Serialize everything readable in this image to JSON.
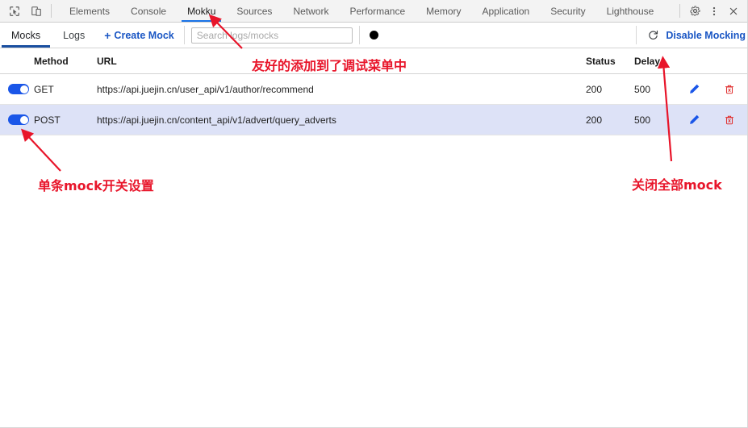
{
  "devtools": {
    "left_icons": [
      {
        "name": "inspect-element-icon",
        "title": "Inspect element"
      },
      {
        "name": "device-toolbar-icon",
        "title": "Toggle device toolbar"
      }
    ],
    "tabs": [
      {
        "label": "Elements",
        "active": false
      },
      {
        "label": "Console",
        "active": false
      },
      {
        "label": "Mokku",
        "active": true
      },
      {
        "label": "Sources",
        "active": false
      },
      {
        "label": "Network",
        "active": false
      },
      {
        "label": "Performance",
        "active": false
      },
      {
        "label": "Memory",
        "active": false
      },
      {
        "label": "Application",
        "active": false
      },
      {
        "label": "Security",
        "active": false
      },
      {
        "label": "Lighthouse",
        "active": false
      }
    ],
    "right_icons": [
      {
        "name": "gear-icon",
        "title": "Settings"
      },
      {
        "name": "kebab-menu-icon",
        "title": "Customize and control DevTools"
      },
      {
        "name": "close-icon",
        "title": "Close DevTools"
      }
    ],
    "active_tab_underline_color": "#1a73e8"
  },
  "toolbar": {
    "tabs": [
      {
        "label": "Mocks",
        "active": true
      },
      {
        "label": "Logs",
        "active": false
      }
    ],
    "create_mock_label": "Create Mock",
    "create_mock_plus": "+",
    "search": {
      "placeholder": "Search logs/mocks",
      "value": ""
    },
    "record_button_name": "record-dot-button",
    "refresh_button_name": "refresh-icon",
    "disable_mocking_label": "Disable Mocking",
    "accent_color": "#1a56c4",
    "active_tab_underline_color": "#1a4fa0"
  },
  "table": {
    "headers": {
      "toggle": "",
      "method": "Method",
      "url": "URL",
      "status": "Status",
      "delay": "Delay"
    },
    "rows": [
      {
        "enabled": true,
        "method": "GET",
        "url": "https://api.juejin.cn/user_api/v1/author/recommend",
        "status": "200",
        "delay": "500",
        "selected": false
      },
      {
        "enabled": true,
        "method": "POST",
        "url": "https://api.juejin.cn/content_api/v1/advert/query_adverts",
        "status": "200",
        "delay": "500",
        "selected": true
      }
    ],
    "selected_row_color": "#dde2f7",
    "edit_icon_color": "#1a56e8",
    "delete_icon_color": "#e03030"
  },
  "annotations": {
    "color": "#e8152a",
    "items": [
      {
        "id": "anno-menu",
        "text": "友好的添加到了调试菜单中"
      },
      {
        "id": "anno-switch",
        "text": "单条mock开关设置"
      },
      {
        "id": "anno-disable",
        "text": "关闭全部mock"
      }
    ]
  }
}
